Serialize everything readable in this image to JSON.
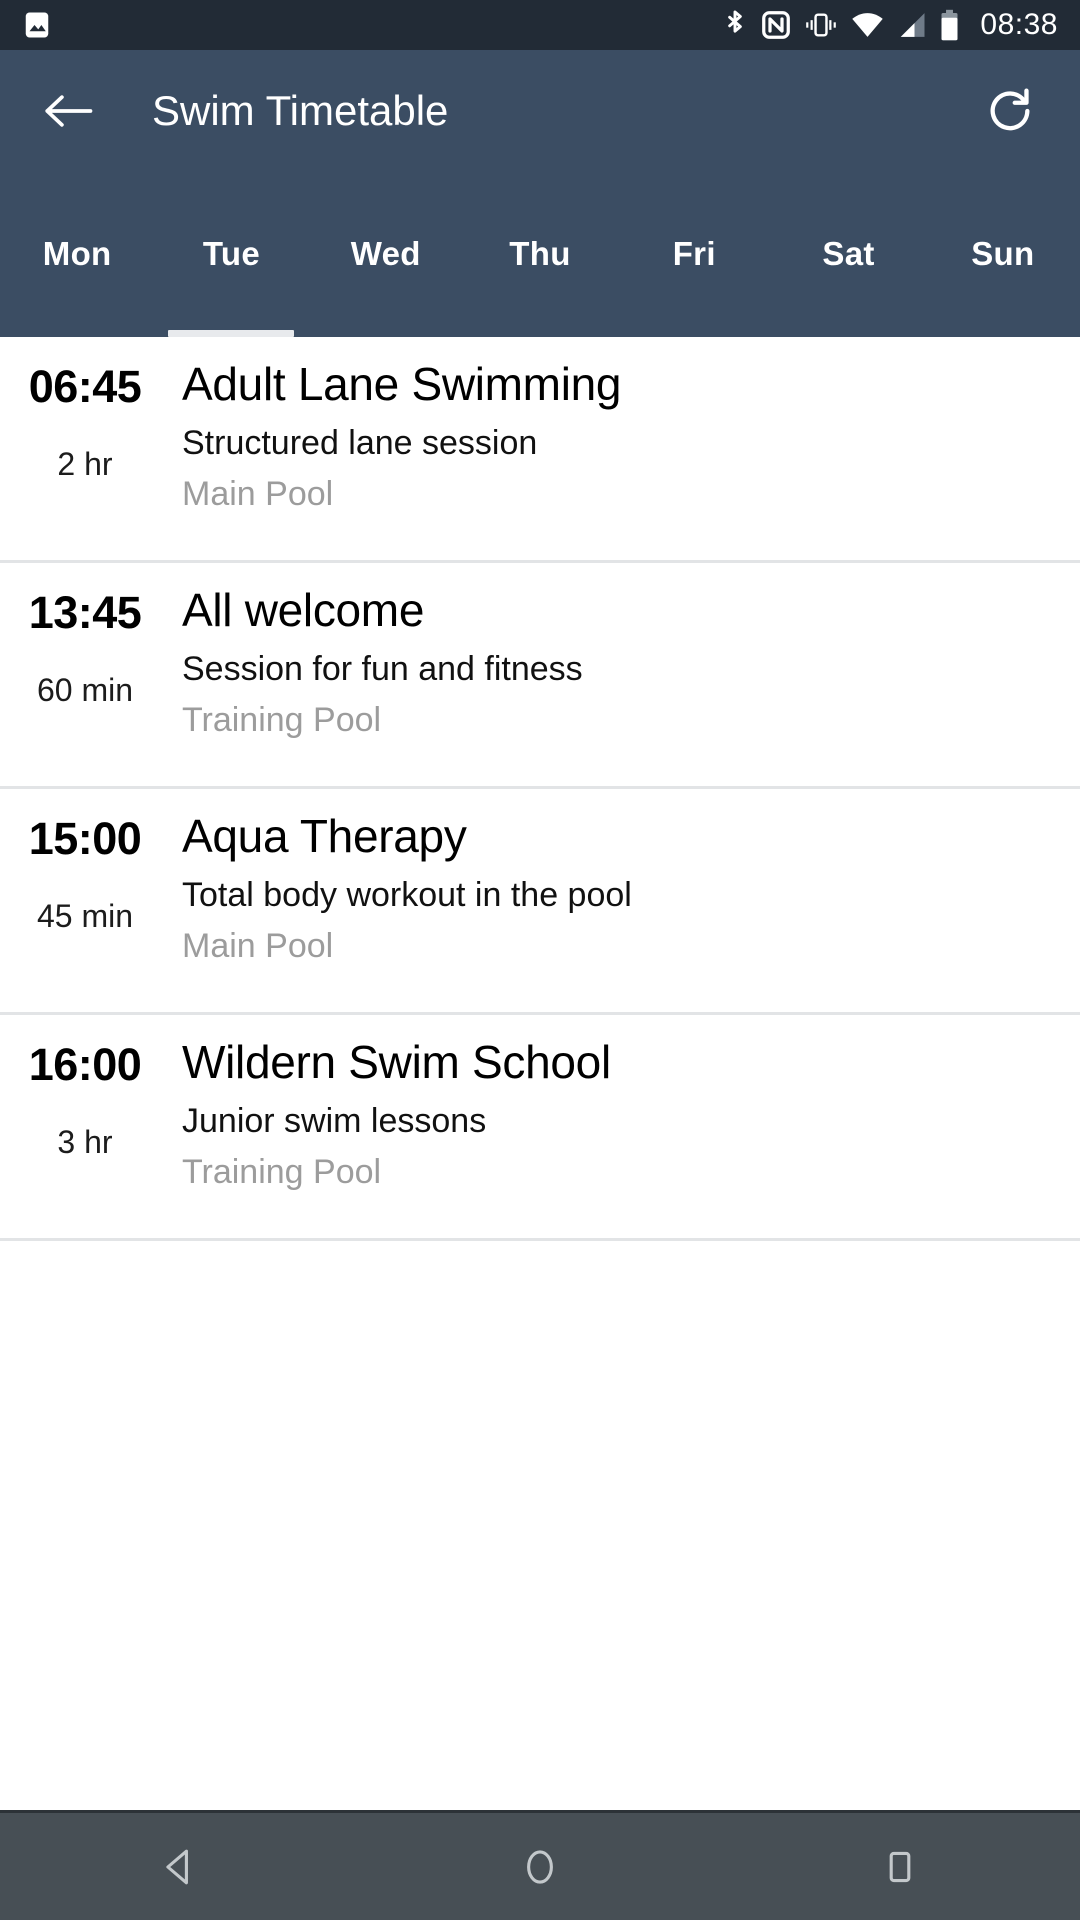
{
  "status_bar": {
    "notification_icon": "image-icon",
    "icons": [
      "bluetooth-icon",
      "nfc-icon",
      "vibrate-icon",
      "wifi-icon",
      "cell-signal-icon",
      "battery-icon"
    ],
    "clock": "08:38",
    "background_color": "#222b36"
  },
  "app_bar": {
    "back_icon": "back-arrow-icon",
    "title": "Swim Timetable",
    "refresh_icon": "refresh-icon",
    "background_color": "#3b4d63"
  },
  "tabs": {
    "items": [
      {
        "label": "Mon",
        "active": false
      },
      {
        "label": "Tue",
        "active": true
      },
      {
        "label": "Wed",
        "active": false
      },
      {
        "label": "Thu",
        "active": false
      },
      {
        "label": "Fri",
        "active": false
      },
      {
        "label": "Sat",
        "active": false
      },
      {
        "label": "Sun",
        "active": false
      }
    ],
    "indicator_color": "#e8eaed"
  },
  "sessions": [
    {
      "time": "06:45",
      "duration": "2 hr",
      "title": "Adult Lane Swimming",
      "description": "Structured lane session",
      "location": "Main Pool"
    },
    {
      "time": "13:45",
      "duration": "60 min",
      "title": "All welcome",
      "description": "Session for fun and fitness",
      "location": "Training Pool"
    },
    {
      "time": "15:00",
      "duration": "45 min",
      "title": "Aqua Therapy",
      "description": "Total body workout in the pool",
      "location": "Main Pool"
    },
    {
      "time": "16:00",
      "duration": "3 hr",
      "title": "Wildern Swim School",
      "description": "Junior swim lessons",
      "location": "Training Pool"
    }
  ],
  "nav_bar": {
    "back_icon": "nav-back-icon",
    "home_icon": "nav-home-icon",
    "recents_icon": "nav-recents-icon",
    "background_color": "#474f55"
  }
}
